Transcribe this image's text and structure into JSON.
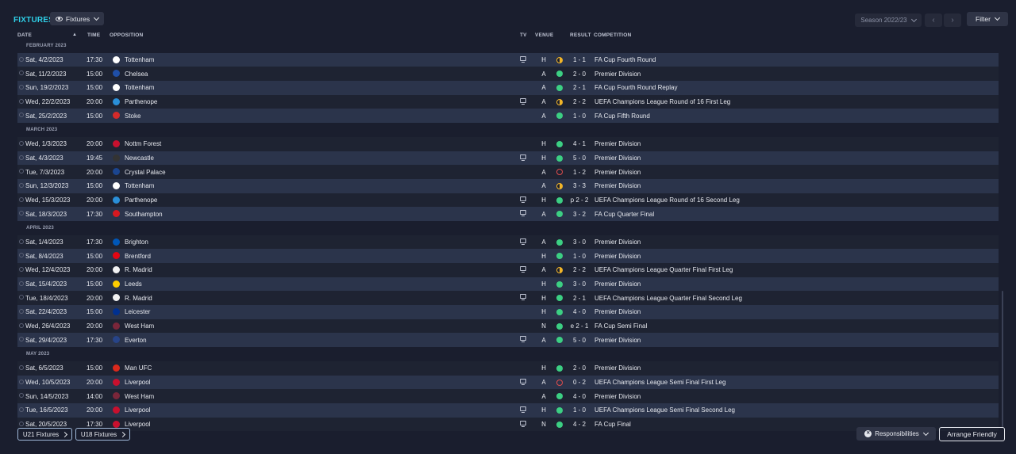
{
  "header": {
    "title": "FIXTURES",
    "view_button": "Fixtures",
    "season": "Season 2022/23",
    "filter": "Filter"
  },
  "columns": {
    "date": "DATE",
    "time": "TIME",
    "opposition": "OPPOSITION",
    "tv": "TV",
    "venue": "VENUE",
    "result": "RESULT",
    "competition": "COMPETITION"
  },
  "rows": [
    {
      "kind": "month",
      "label": "FEBRUARY 2023"
    },
    {
      "kind": "match",
      "date": "Sat, 4/2/2023",
      "time": "17:30",
      "opp": "Tottenham",
      "crest": "#ffffff",
      "tv": true,
      "venue": "H",
      "outcome": "D",
      "result": "1 - 1",
      "comp": "FA Cup Fourth Round"
    },
    {
      "kind": "match",
      "date": "Sat, 11/2/2023",
      "time": "15:00",
      "opp": "Chelsea",
      "crest": "#1f4fa8",
      "tv": false,
      "venue": "A",
      "outcome": "W",
      "result": "2 - 0",
      "comp": "Premier Division"
    },
    {
      "kind": "match",
      "date": "Sun, 19/2/2023",
      "time": "15:00",
      "opp": "Tottenham",
      "crest": "#ffffff",
      "tv": false,
      "venue": "A",
      "outcome": "W",
      "result": "2 - 1",
      "comp": "FA Cup Fourth Round Replay"
    },
    {
      "kind": "match",
      "date": "Wed, 22/2/2023",
      "time": "20:00",
      "opp": "Parthenope",
      "crest": "#2a8fd8",
      "tv": true,
      "venue": "A",
      "outcome": "D",
      "result": "2 - 2",
      "comp": "UEFA Champions League Round of 16 First Leg"
    },
    {
      "kind": "match",
      "date": "Sat, 25/2/2023",
      "time": "15:00",
      "opp": "Stoke",
      "crest": "#d42a2a",
      "tv": false,
      "venue": "A",
      "outcome": "W",
      "result": "1 - 0",
      "comp": "FA Cup Fifth Round"
    },
    {
      "kind": "month",
      "label": "MARCH 2023"
    },
    {
      "kind": "match",
      "date": "Wed, 1/3/2023",
      "time": "20:00",
      "opp": "Nottm Forest",
      "crest": "#c8102e",
      "tv": false,
      "venue": "H",
      "outcome": "W",
      "result": "4 - 1",
      "comp": "Premier Division"
    },
    {
      "kind": "match",
      "date": "Sat, 4/3/2023",
      "time": "19:45",
      "opp": "Newcastle",
      "crest": "#333333",
      "tv": true,
      "venue": "H",
      "outcome": "W",
      "result": "5 - 0",
      "comp": "Premier Division"
    },
    {
      "kind": "match",
      "date": "Tue, 7/3/2023",
      "time": "20:00",
      "opp": "Crystal Palace",
      "crest": "#1b458f",
      "tv": false,
      "venue": "A",
      "outcome": "L",
      "result": "1 - 2",
      "comp": "Premier Division"
    },
    {
      "kind": "match",
      "date": "Sun, 12/3/2023",
      "time": "15:00",
      "opp": "Tottenham",
      "crest": "#ffffff",
      "tv": false,
      "venue": "A",
      "outcome": "D",
      "result": "3 - 3",
      "comp": "Premier Division"
    },
    {
      "kind": "match",
      "date": "Wed, 15/3/2023",
      "time": "20:00",
      "opp": "Parthenope",
      "crest": "#2a8fd8",
      "tv": true,
      "venue": "H",
      "outcome": "W",
      "result": "p 2 - 2",
      "comp": "UEFA Champions League Round of 16 Second Leg"
    },
    {
      "kind": "match",
      "date": "Sat, 18/3/2023",
      "time": "17:30",
      "opp": "Southampton",
      "crest": "#d71920",
      "tv": true,
      "venue": "A",
      "outcome": "W",
      "result": "3 - 2",
      "comp": "FA Cup Quarter Final"
    },
    {
      "kind": "month",
      "label": "APRIL 2023"
    },
    {
      "kind": "match",
      "date": "Sat, 1/4/2023",
      "time": "17:30",
      "opp": "Brighton",
      "crest": "#0057b8",
      "tv": true,
      "venue": "A",
      "outcome": "W",
      "result": "3 - 0",
      "comp": "Premier Division"
    },
    {
      "kind": "match",
      "date": "Sat, 8/4/2023",
      "time": "15:00",
      "opp": "Brentford",
      "crest": "#e30613",
      "tv": false,
      "venue": "H",
      "outcome": "W",
      "result": "1 - 0",
      "comp": "Premier Division"
    },
    {
      "kind": "match",
      "date": "Wed, 12/4/2023",
      "time": "20:00",
      "opp": "R. Madrid",
      "crest": "#f2f2f2",
      "tv": true,
      "venue": "A",
      "outcome": "D",
      "result": "2 - 2",
      "comp": "UEFA Champions League Quarter Final First Leg"
    },
    {
      "kind": "match",
      "date": "Sat, 15/4/2023",
      "time": "15:00",
      "opp": "Leeds",
      "crest": "#ffcd00",
      "tv": false,
      "venue": "H",
      "outcome": "W",
      "result": "3 - 0",
      "comp": "Premier Division"
    },
    {
      "kind": "match",
      "date": "Tue, 18/4/2023",
      "time": "20:00",
      "opp": "R. Madrid",
      "crest": "#f2f2f2",
      "tv": true,
      "venue": "H",
      "outcome": "W",
      "result": "2 - 1",
      "comp": "UEFA Champions League Quarter Final Second Leg"
    },
    {
      "kind": "match",
      "date": "Sat, 22/4/2023",
      "time": "15:00",
      "opp": "Leicester",
      "crest": "#003090",
      "tv": false,
      "venue": "H",
      "outcome": "W",
      "result": "4 - 0",
      "comp": "Premier Division"
    },
    {
      "kind": "match",
      "date": "Wed, 26/4/2023",
      "time": "20:00",
      "opp": "West Ham",
      "crest": "#7a263a",
      "tv": false,
      "venue": "N",
      "outcome": "W",
      "result": "e 2 - 1",
      "comp": "FA Cup Semi Final"
    },
    {
      "kind": "match",
      "date": "Sat, 29/4/2023",
      "time": "17:30",
      "opp": "Everton",
      "crest": "#274488",
      "tv": true,
      "venue": "A",
      "outcome": "W",
      "result": "5 - 0",
      "comp": "Premier Division"
    },
    {
      "kind": "month",
      "label": "MAY 2023"
    },
    {
      "kind": "match",
      "date": "Sat, 6/5/2023",
      "time": "15:00",
      "opp": "Man UFC",
      "crest": "#da291c",
      "tv": false,
      "venue": "H",
      "outcome": "W",
      "result": "2 - 0",
      "comp": "Premier Division"
    },
    {
      "kind": "match",
      "date": "Wed, 10/5/2023",
      "time": "20:00",
      "opp": "Liverpool",
      "crest": "#c8102e",
      "tv": true,
      "venue": "A",
      "outcome": "L",
      "result": "0 - 2",
      "comp": "UEFA Champions League Semi Final First Leg"
    },
    {
      "kind": "match",
      "date": "Sun, 14/5/2023",
      "time": "14:00",
      "opp": "West Ham",
      "crest": "#7a263a",
      "tv": false,
      "venue": "A",
      "outcome": "W",
      "result": "4 - 0",
      "comp": "Premier Division"
    },
    {
      "kind": "match",
      "date": "Tue, 16/5/2023",
      "time": "20:00",
      "opp": "Liverpool",
      "crest": "#c8102e",
      "tv": true,
      "venue": "H",
      "outcome": "W",
      "result": "1 - 0",
      "comp": "UEFA Champions League Semi Final Second Leg"
    },
    {
      "kind": "match",
      "date": "Sat, 20/5/2023",
      "time": "17:30",
      "opp": "Liverpool",
      "crest": "#c8102e",
      "tv": true,
      "venue": "N",
      "outcome": "W",
      "result": "4 - 2",
      "comp": "FA Cup Final"
    }
  ],
  "footer": {
    "u21": "U21 Fixtures",
    "u18": "U18 Fixtures",
    "responsibilities": "Responsibilities",
    "arrange": "Arrange Friendly"
  },
  "colors": {
    "accent": "#2fd0e8",
    "win": "#3ccf83",
    "draw": "#f0b429",
    "loss": "#e04d4d"
  }
}
